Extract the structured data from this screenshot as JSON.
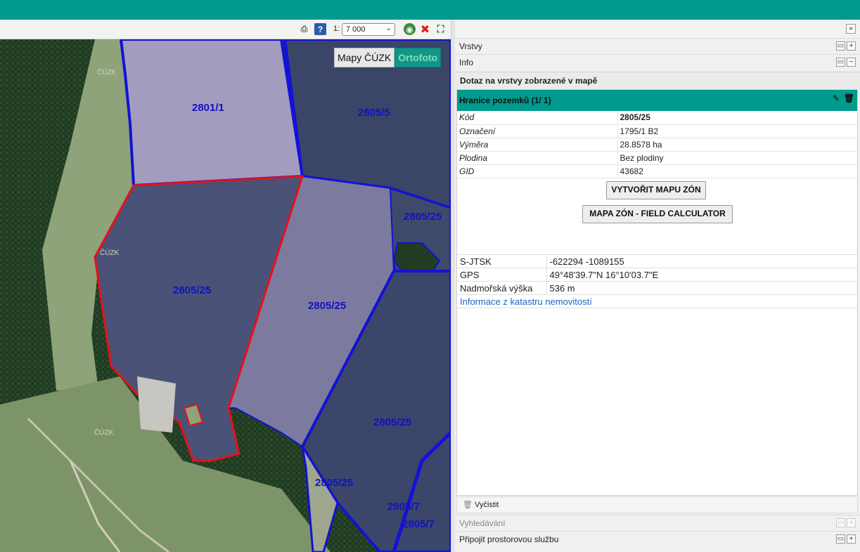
{
  "map": {
    "scale_prefix": "1:",
    "scale_value": "7 000",
    "tabs": [
      "Mapy ČÚZK",
      "Ortofoto"
    ],
    "watermark": "ČÚZK",
    "parcel_labels": [
      "2801/1",
      "2805/5",
      "2805/25",
      "2805/25",
      "2805/25",
      "2805/25",
      "2805/25",
      "2805/7",
      "2805/7"
    ]
  },
  "panel": {
    "sections": {
      "vrstvy": "Vrstvy",
      "info": "Info",
      "query_title": "Dotaz na vrstvy zobrazené v mapě",
      "vyhledavani": "Vyhledávání",
      "pripojit": "Připojit prostorovou službu"
    },
    "layer_header": "Hranice pozemků (1/ 1)",
    "attributes": [
      {
        "key": "Kód",
        "value": "2805/25"
      },
      {
        "key": "Označení",
        "value": "1795/1 B2"
      },
      {
        "key": "Výměra",
        "value": "28.8578 ha"
      },
      {
        "key": "Plodina",
        "value": "Bez plodiny"
      },
      {
        "key": "GID",
        "value": "43682"
      }
    ],
    "buttons": {
      "zone_map": "VYTVOŘIT MAPU ZÓN",
      "field_calc": "MAPA ZÓN - FIELD CALCULATOR"
    },
    "coords": [
      {
        "key": "S-JTSK",
        "value": "-622294 -1089155"
      },
      {
        "key": "GPS",
        "value": "49°48'39.7\"N 16°10'03.7\"E"
      },
      {
        "key": "Nadmořská výška",
        "value": "536 m"
      }
    ],
    "cadastre_link": "Informace z katastru nemovitostí",
    "clear_label": "Vyčistit"
  },
  "colors": {
    "accent": "#009a8e",
    "parcel_border": "#0000cc",
    "selected_parcel": "#e8101a"
  }
}
